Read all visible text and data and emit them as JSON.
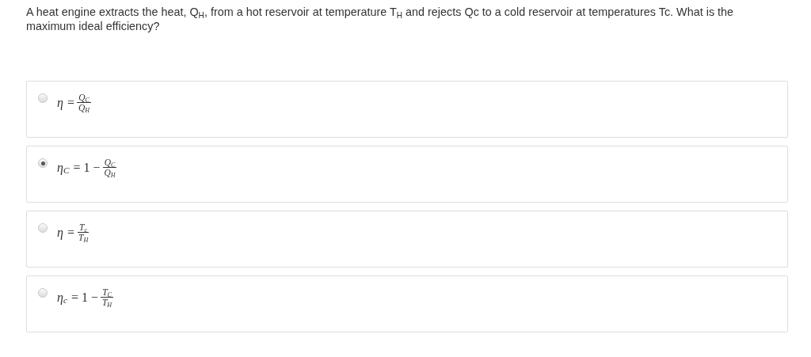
{
  "question": "A heat engine extracts the heat, Q$_{H}$, from a hot reservoir at temperature T$_{H}$ and rejects Qc to a cold reservoir at temperatures Tc. What is the maximum ideal efficiency?",
  "options": [
    {
      "selected": false,
      "symbol": "η",
      "operator": "=",
      "numerator": "Q$_{C}$",
      "denominator": "Q$_{H}$"
    },
    {
      "selected": true,
      "symbol": "η$_{C}$",
      "operator": "= 1 −",
      "numerator": "Q$_{C}$",
      "denominator": "Q$_{H}$"
    },
    {
      "selected": false,
      "symbol": "η",
      "operator": "=",
      "numerator": "T$_{c}$",
      "denominator": "T$_{H}$"
    },
    {
      "selected": false,
      "symbol": "η$_{c}$",
      "operator": "= 1 −",
      "numerator": "T$_{C}$",
      "denominator": "T$_{H}$"
    }
  ]
}
